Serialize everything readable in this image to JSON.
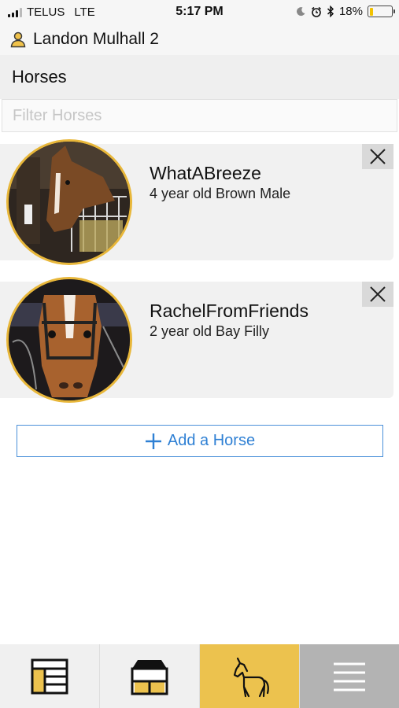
{
  "status_bar": {
    "carrier": "TELUS",
    "network": "LTE",
    "time": "5:17 PM",
    "battery": "18%",
    "battery_level": 0.18,
    "icons": [
      "moon-icon",
      "alarm-icon",
      "bluetooth-icon"
    ]
  },
  "user": {
    "name": "Landon Mulhall 2",
    "icon": "user-icon"
  },
  "section": {
    "title": "Horses"
  },
  "filter": {
    "placeholder": "Filter Horses",
    "value": ""
  },
  "horses": [
    {
      "name": "WhatABreeze",
      "description": "4 year old Brown Male"
    },
    {
      "name": "RachelFromFriends",
      "description": "2 year old Bay Filly"
    }
  ],
  "add_button": {
    "label": "Add a Horse",
    "icon": "plus-icon"
  },
  "tabs": [
    {
      "name": "records",
      "icon": "records-icon",
      "active": false
    },
    {
      "name": "barn",
      "icon": "barn-icon",
      "active": false
    },
    {
      "name": "horses",
      "icon": "horse-icon",
      "active": true
    },
    {
      "name": "menu",
      "icon": "hamburger-icon",
      "active": false
    }
  ],
  "colors": {
    "accent": "#ecc24e",
    "avatar_border": "#e8b73a",
    "link_blue": "#2f80d4"
  }
}
